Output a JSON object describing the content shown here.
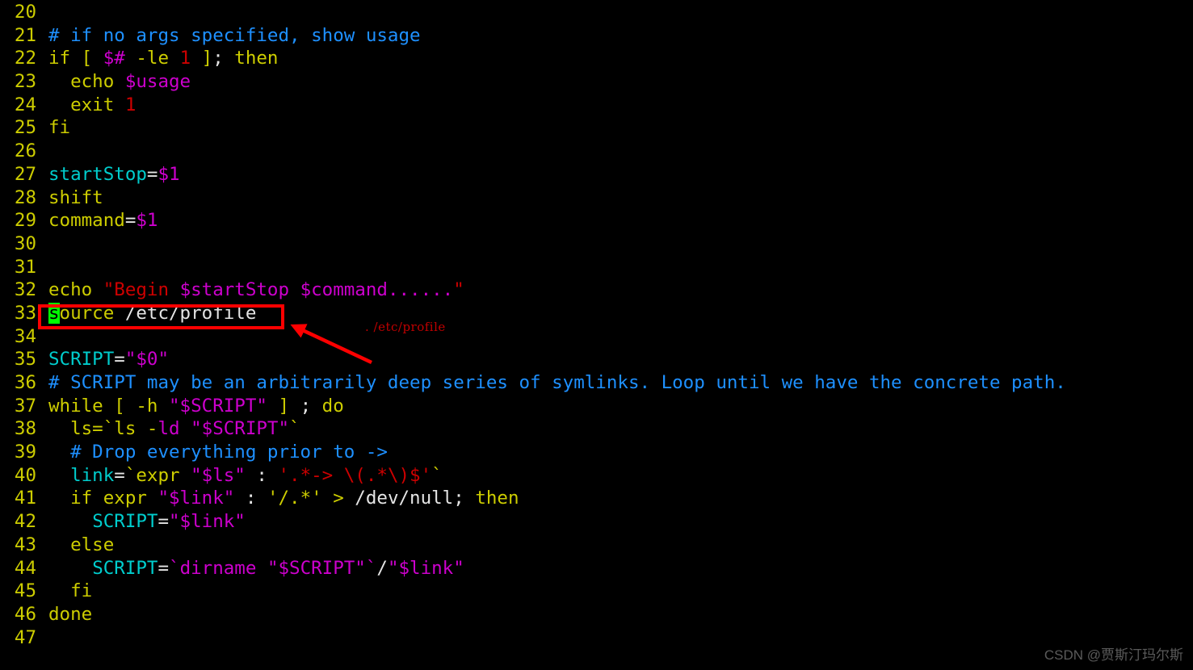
{
  "editor": {
    "background_color": "#000000",
    "lineno_color": "#cdcd00",
    "first_line": 20,
    "last_line": 47,
    "cursor": {
      "line": 33,
      "column": 1,
      "char": "s",
      "bg_color": "#00ff00",
      "fg_color": "#000000"
    }
  },
  "palette": {
    "keyword": "#cdcd00",
    "comment": "#1e90ff",
    "variable": "#cd00cd",
    "number": "#cd0000",
    "string": "#cd0000",
    "identifier": "#00cdcd",
    "plain": "#e5e5e5",
    "annotation_red": "#fe0000"
  },
  "lines": [
    {
      "no": "20",
      "tokens": []
    },
    {
      "no": "21",
      "tokens": [
        {
          "t": "# if no args specified, show usage",
          "c": "cmt"
        }
      ]
    },
    {
      "no": "22",
      "tokens": [
        {
          "t": "if [ ",
          "c": "kw"
        },
        {
          "t": "$#",
          "c": "var"
        },
        {
          "t": " -le ",
          "c": "kw"
        },
        {
          "t": "1",
          "c": "num"
        },
        {
          "t": " ]",
          "c": "kw"
        },
        {
          "t": "; ",
          "c": "plain"
        },
        {
          "t": "then",
          "c": "kw"
        }
      ]
    },
    {
      "no": "23",
      "tokens": [
        {
          "t": "  echo ",
          "c": "kw"
        },
        {
          "t": "$usage",
          "c": "var"
        }
      ]
    },
    {
      "no": "24",
      "tokens": [
        {
          "t": "  exit ",
          "c": "kw"
        },
        {
          "t": "1",
          "c": "num"
        }
      ]
    },
    {
      "no": "25",
      "tokens": [
        {
          "t": "fi",
          "c": "kw"
        }
      ]
    },
    {
      "no": "26",
      "tokens": []
    },
    {
      "no": "27",
      "tokens": [
        {
          "t": "startStop",
          "c": "ident"
        },
        {
          "t": "=",
          "c": "plain"
        },
        {
          "t": "$1",
          "c": "var"
        }
      ]
    },
    {
      "no": "28",
      "tokens": [
        {
          "t": "shift",
          "c": "kw"
        }
      ]
    },
    {
      "no": "29",
      "tokens": [
        {
          "t": "command",
          "c": "kw"
        },
        {
          "t": "=",
          "c": "plain"
        },
        {
          "t": "$1",
          "c": "var"
        }
      ]
    },
    {
      "no": "30",
      "tokens": []
    },
    {
      "no": "31",
      "tokens": []
    },
    {
      "no": "32",
      "tokens": [
        {
          "t": "echo ",
          "c": "kw"
        },
        {
          "t": "\"Begin ",
          "c": "str"
        },
        {
          "t": "$startStop $command......",
          "c": "var"
        },
        {
          "t": "\"",
          "c": "str"
        }
      ]
    },
    {
      "no": "33",
      "cursor_first": true,
      "tokens": [
        {
          "t": "s",
          "c": "cursor"
        },
        {
          "t": "ource",
          "c": "kw"
        },
        {
          "t": " /etc/profile",
          "c": "plain"
        }
      ]
    },
    {
      "no": "34",
      "tokens": []
    },
    {
      "no": "35",
      "tokens": [
        {
          "t": "SCRIPT",
          "c": "ident"
        },
        {
          "t": "=",
          "c": "plain"
        },
        {
          "t": "\"$0\"",
          "c": "var"
        }
      ]
    },
    {
      "no": "36",
      "tokens": [
        {
          "t": "# SCRIPT may be an arbitrarily deep series of symlinks. Loop until we have the concrete path.",
          "c": "cmt"
        }
      ]
    },
    {
      "no": "37",
      "tokens": [
        {
          "t": "while [ -h ",
          "c": "kw"
        },
        {
          "t": "\"$SCRIPT\"",
          "c": "var"
        },
        {
          "t": " ] ",
          "c": "kw"
        },
        {
          "t": "; ",
          "c": "plain"
        },
        {
          "t": "do",
          "c": "kw"
        }
      ]
    },
    {
      "no": "38",
      "tokens": [
        {
          "t": "  ls=`ls -",
          "c": "kw"
        },
        {
          "t": "ld ",
          "c": "var"
        },
        {
          "t": "\"$SCRIPT\"",
          "c": "var"
        },
        {
          "t": "`",
          "c": "kw"
        }
      ]
    },
    {
      "no": "39",
      "tokens": [
        {
          "t": "  # Drop everything prior to ->",
          "c": "cmt"
        }
      ]
    },
    {
      "no": "40",
      "tokens": [
        {
          "t": "  ",
          "c": "plain"
        },
        {
          "t": "link",
          "c": "ident"
        },
        {
          "t": "=",
          "c": "plain"
        },
        {
          "t": "`",
          "c": "kw"
        },
        {
          "t": "expr ",
          "c": "kw"
        },
        {
          "t": "\"$ls\"",
          "c": "var"
        },
        {
          "t": " : ",
          "c": "plain"
        },
        {
          "t": "'.*-> \\(.*\\)$'",
          "c": "num"
        },
        {
          "t": "`",
          "c": "kw"
        }
      ]
    },
    {
      "no": "41",
      "tokens": [
        {
          "t": "  if expr ",
          "c": "kw"
        },
        {
          "t": "\"$link\"",
          "c": "var"
        },
        {
          "t": " : ",
          "c": "plain"
        },
        {
          "t": "'/.*'",
          "c": "kw"
        },
        {
          "t": " ",
          "c": "plain"
        },
        {
          "t": ">",
          "c": "kw"
        },
        {
          "t": " /dev/null",
          "c": "plain"
        },
        {
          "t": "; ",
          "c": "plain"
        },
        {
          "t": "then",
          "c": "kw"
        }
      ]
    },
    {
      "no": "42",
      "tokens": [
        {
          "t": "    ",
          "c": "plain"
        },
        {
          "t": "SCRIPT",
          "c": "ident"
        },
        {
          "t": "=",
          "c": "plain"
        },
        {
          "t": "\"$link\"",
          "c": "var"
        }
      ]
    },
    {
      "no": "43",
      "tokens": [
        {
          "t": "  else",
          "c": "kw"
        }
      ]
    },
    {
      "no": "44",
      "tokens": [
        {
          "t": "    ",
          "c": "plain"
        },
        {
          "t": "SCRIPT",
          "c": "ident"
        },
        {
          "t": "=",
          "c": "plain"
        },
        {
          "t": "`",
          "c": "var"
        },
        {
          "t": "dirname ",
          "c": "var"
        },
        {
          "t": "\"$SCRIPT\"",
          "c": "var"
        },
        {
          "t": "`",
          "c": "var"
        },
        {
          "t": "/",
          "c": "plain"
        },
        {
          "t": "\"$link\"",
          "c": "var"
        }
      ]
    },
    {
      "no": "45",
      "tokens": [
        {
          "t": "  fi",
          "c": "kw"
        }
      ]
    },
    {
      "no": "46",
      "tokens": [
        {
          "t": "done",
          "c": "kw"
        }
      ]
    },
    {
      "no": "47",
      "tokens": []
    }
  ],
  "annotation": {
    "box_target_line": "33",
    "box_target_text": "source /etc/profile",
    "label": ". /etc/profile",
    "color": "#fe0000"
  },
  "watermark": {
    "text": "CSDN @贾斯汀玛尔斯"
  }
}
